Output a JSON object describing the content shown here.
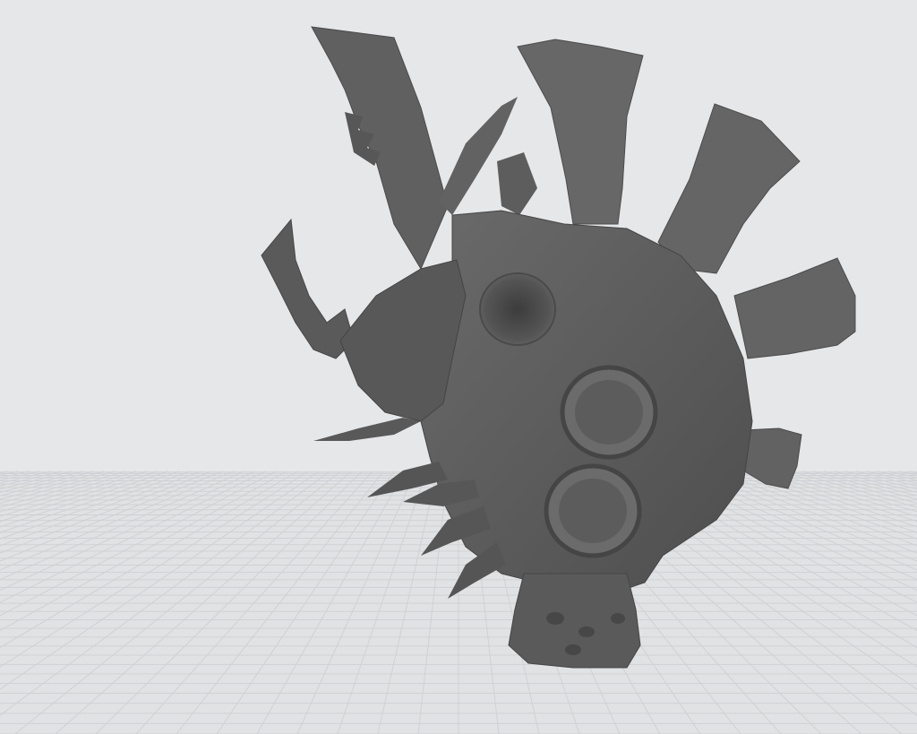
{
  "viewport": {
    "background_color": "#e6e7e9",
    "grid_floor_color": "#e2e3e5",
    "grid_line_color": "#cfd1d4",
    "model_color": "#5e5e5e",
    "model_shadow_color": "#3f3f3f",
    "model_highlight_color": "#7a7a7a",
    "grid_visible": true
  },
  "scene": {
    "model_name_icon": "sculpted-creature-head-model"
  }
}
